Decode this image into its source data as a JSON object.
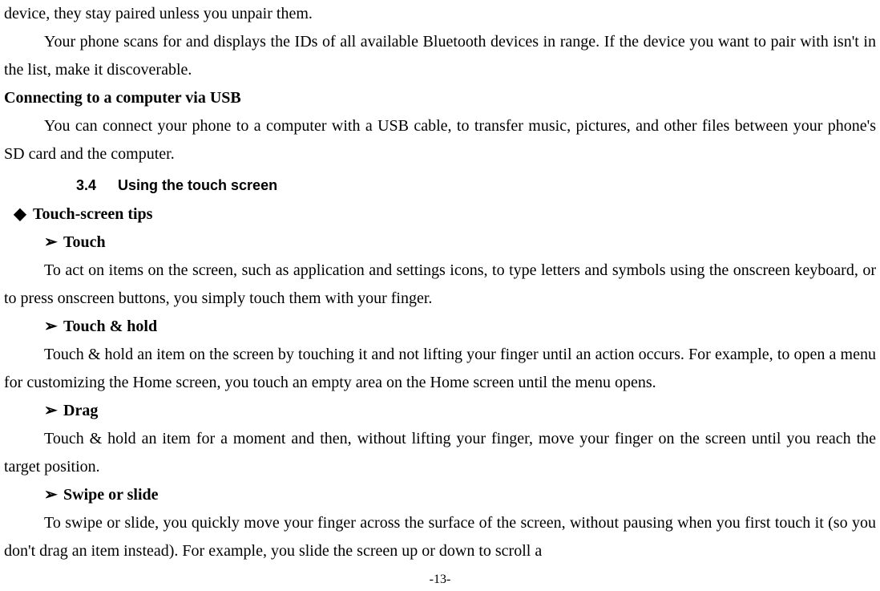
{
  "p1": "device, they stay paired unless you unpair them.",
  "p2": "Your phone scans for and displays the IDs of all available Bluetooth devices in range. If the device you want to pair with isn't in the list, make it discoverable.",
  "h1": "Connecting to a computer via USB",
  "p3": "You can connect your phone to a computer with a USB cable, to transfer music, pictures, and other files between your phone's SD card and the computer.",
  "section": {
    "num": "3.4",
    "title": "Using the touch screen"
  },
  "tips_title": "Touch-screen tips",
  "touch": {
    "title": "Touch",
    "body": "To act on items on the screen, such as application and settings icons, to type letters and symbols using the onscreen keyboard, or to press onscreen buttons, you simply touch them with your finger."
  },
  "touch_hold": {
    "title": "Touch & hold",
    "body": "Touch & hold an item on the screen by touching it and not lifting your finger until an action occurs. For example, to open a menu for customizing the Home screen, you touch an empty area on the Home screen until the menu opens."
  },
  "drag": {
    "title": "Drag",
    "body": "Touch & hold an item for a moment and then, without lifting your finger, move your finger on the screen until you reach the target position."
  },
  "swipe": {
    "title": "Swipe or slide",
    "body": "To swipe or slide, you quickly move your finger across the surface of the screen, without pausing when you first touch it (so you don't drag an item instead). For example, you slide the screen up or down to scroll a"
  },
  "page_number": "-13-",
  "bullets": {
    "diamond": "◆",
    "arrow": "➢"
  }
}
